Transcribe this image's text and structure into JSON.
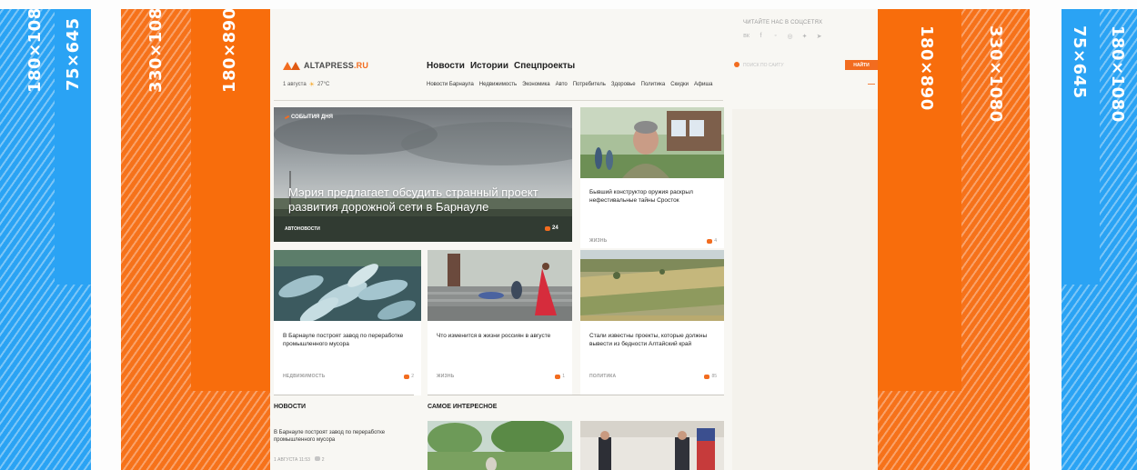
{
  "zones": {
    "left_outer": "180×1080",
    "left_narrow": "75×645",
    "left_wide": "330×1080",
    "left_inner": "180×890",
    "right_inner": "180×890",
    "right_wide": "330×1080",
    "right_narrow": "75×645",
    "right_outer": "180×1080"
  },
  "colors": {
    "accent": "#f26c1f",
    "blue": "#2aa3f4",
    "orange": "#f86d0c"
  },
  "site": {
    "social_title": "ЧИТАЙТЕ НАС В СОЦСЕТЯХ",
    "social_icons": [
      "vk-icon",
      "facebook-icon",
      "odnoklassniki-icon",
      "instagram-icon",
      "twitter-icon",
      "telegram-icon"
    ],
    "logo": {
      "name": "ALTAPRESS",
      "tld": ".RU"
    },
    "date": "1 августа",
    "temperature": "27°С",
    "main_nav": [
      "Новости",
      "Истории",
      "Спецпроекты"
    ],
    "search": {
      "placeholder": "ПОИСК ПО САЙТУ",
      "button": "НАЙТИ"
    },
    "sub_nav": [
      "Новости Барнаула",
      "Недвижимость",
      "Экономика",
      "Авто",
      "Потребитель",
      "Здоровье",
      "Политика",
      "Скидки",
      "Афиша"
    ],
    "sub_nav_more": "—"
  },
  "hero": {
    "tag": "СОБЫТИЯ ДНЯ",
    "title": "Мэрия предлагает обсудить странный проект развития дорожной сети в Барнауле",
    "category": "АВТОНОВОСТИ",
    "comments": "24"
  },
  "side_story": {
    "title": "Бывший конструктор оружия раскрыл нефестивальные тайны Сросток",
    "category": "ЖИЗНЬ",
    "comments": "4"
  },
  "cards": [
    {
      "title": "В Барнауле построят завод по переработке промышленного мусора",
      "category": "НЕДВИЖИМОСТЬ",
      "comments": "2"
    },
    {
      "title": "Что изменится в жизни россиян в августе",
      "category": "ЖИЗНЬ",
      "comments": "1"
    },
    {
      "title": "Стали известны проекты, которые должны вывести из бедности Алтайский край",
      "category": "ПОЛИТИКА",
      "comments": "85"
    }
  ],
  "sections": {
    "news": "НОВОСТИ",
    "popular": "САМОЕ ИНТЕРЕСНОЕ"
  },
  "news_item": {
    "title": "В Барнауле построят завод по переработке промышленного мусора",
    "meta": "1 АВГУСТА 11:53",
    "comments": "2"
  }
}
